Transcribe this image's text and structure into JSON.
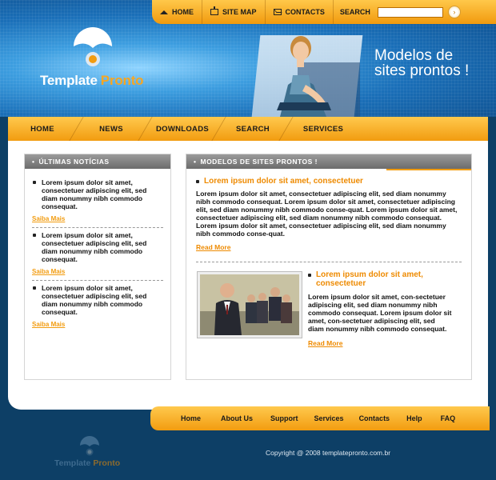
{
  "topnav": {
    "home": "HOME",
    "sitemap": "SITE MAP",
    "contacts": "CONTACTS",
    "search_label": "SEARCH",
    "search_value": ""
  },
  "logo": {
    "part1": "Template",
    "part2": "Pronto"
  },
  "tagline": {
    "line1": "Modelos de",
    "line2": "sites prontos !"
  },
  "mainmenu": [
    "HOME",
    "NEWS",
    "DOWNLOADS",
    "SEARCH",
    "SERVICES"
  ],
  "left_box": {
    "title": "ÚLTIMAS NOTÍCIAS",
    "items": [
      {
        "text": "Lorem ipsum dolor sit amet, consectetuer adipiscing elit, sed diam nonummy nibh commodo consequat.",
        "link": "Saiba Mais"
      },
      {
        "text": "Lorem ipsum dolor sit amet, consectetuer adipiscing elit, sed diam nonummy nibh commodo consequat.",
        "link": "Saiba Mais"
      },
      {
        "text": "Lorem ipsum dolor sit amet, consectetuer adipiscing elit, sed diam nonummy nibh commodo consequat.",
        "link": "Saiba Mais"
      }
    ]
  },
  "right_box": {
    "title": "MODELOS DE SITES PRONTOS !",
    "article1": {
      "title": "Lorem ipsum dolor sit amet, consectetuer",
      "body": "Lorem ipsum dolor sit amet, consectetuer adipiscing elit, sed diam nonummy nibh commodo consequat. Lorem ipsum dolor sit amet, consectetuer adipiscing elit, sed diam nonummy nibh commodo conse-quat. Lorem ipsum dolor sit amet, consectetuer adipiscing elit, sed diam nonummy nibh commodo consequat. Lorem ipsum dolor sit amet, consectetuer adipiscing elit, sed diam nonummy nibh commodo conse-quat.",
      "link": "Read More"
    },
    "article2": {
      "title": "Lorem ipsum dolor sit amet, consectetuer",
      "body": "Lorem ipsum dolor sit amet, con-sectetuer adipiscing elit, sed diam nonummy nibh commodo consequat. Lorem ipsum dolor sit amet, con-sectetuer adipiscing elit, sed diam nonummy nibh commodo consequat.",
      "link": "Read More"
    }
  },
  "footnav": [
    "Home",
    "About Us",
    "Support",
    "Services",
    "Contacts",
    "Help",
    "FAQ"
  ],
  "footer": {
    "logo1": "Template",
    "logo2": "Pronto",
    "copyright": "Copyright @ 2008 templatepronto.com.br"
  },
  "colors": {
    "accent": "#f29c10",
    "accent_text": "#ee8a00",
    "page_bg": "#0d3f66",
    "header_blue": "#1a6fb8"
  }
}
